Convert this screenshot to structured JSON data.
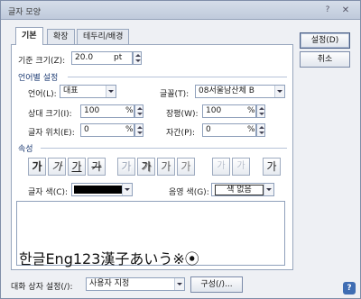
{
  "window": {
    "title": "글자 모양",
    "help_glyph": "?",
    "close_glyph": "✕"
  },
  "tabs": [
    {
      "label": "기본",
      "active": true
    },
    {
      "label": "확장",
      "active": false
    },
    {
      "label": "테두리/배경",
      "active": false
    }
  ],
  "basic": {
    "size_label": "기준 크기(Z):",
    "size_value": "20.0",
    "size_unit": "pt"
  },
  "lang_section": {
    "title": "언어별 설정",
    "language_label": "언어(L):",
    "language_value": "대표",
    "font_label": "글꼴(T):",
    "font_value": "08서울남산체 B",
    "rel_size_label": "상대 크기(I):",
    "rel_size_value": "100",
    "rel_size_unit": "%",
    "width_label": "장평(W):",
    "width_value": "100",
    "width_unit": "%",
    "position_label": "글자 위치(E):",
    "position_value": "0",
    "position_unit": "%",
    "spacing_label": "자간(P):",
    "spacing_value": "0",
    "spacing_unit": "%"
  },
  "attr_section": {
    "title": "속성",
    "effect_buttons": [
      "가",
      "가",
      "가",
      "가",
      "가",
      "가",
      "가",
      "가",
      "가",
      "가",
      "가"
    ],
    "text_color_label": "글자 색(C):",
    "text_color": "#000000",
    "shade_color_label": "음영 색(G):",
    "shade_color_value": "색 없음"
  },
  "preview": {
    "text": "한글Eng123漢子あいう※⦿"
  },
  "buttons": {
    "ok": "설정(D)",
    "cancel": "취소"
  },
  "bottom": {
    "dialog_setting_label": "대화 상자 설정(/):",
    "dialog_setting_value": "사용자 지정",
    "compose_button": "구성(/)..."
  },
  "colors": {
    "accent": "#3f6db3",
    "panel_border": "#98a6bd"
  }
}
